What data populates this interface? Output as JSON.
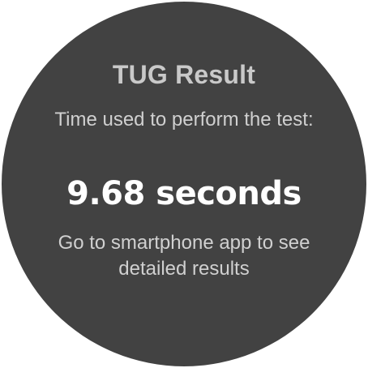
{
  "screen": {
    "title": "TUG Result",
    "time_label": "Time used to perform the test:",
    "result_value": "9.68 seconds",
    "hint": "Go to smartphone app to see detailed results"
  },
  "colors": {
    "face_background": "#424242",
    "page_background": "#ffffff",
    "result_text": "#ffffff",
    "body_text": "#d0d0d0"
  }
}
